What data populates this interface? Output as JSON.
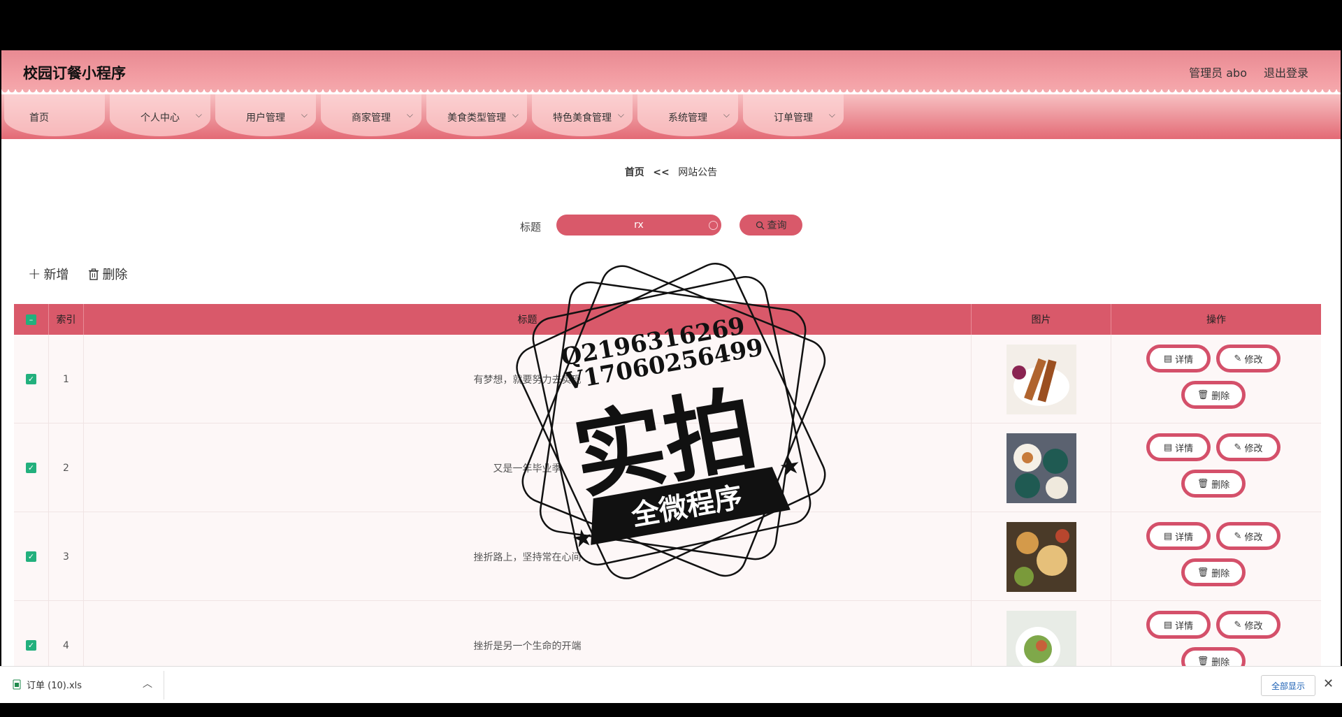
{
  "header": {
    "title": "校园订餐小程序",
    "user": "管理员 abo",
    "logout": "退出登录"
  },
  "nav": [
    {
      "label": "首页",
      "has_menu": false
    },
    {
      "label": "个人中心",
      "has_menu": true
    },
    {
      "label": "用户管理",
      "has_menu": true
    },
    {
      "label": "商家管理",
      "has_menu": true
    },
    {
      "label": "美食类型管理",
      "has_menu": true
    },
    {
      "label": "特色美食管理",
      "has_menu": true
    },
    {
      "label": "系统管理",
      "has_menu": true
    },
    {
      "label": "订单管理",
      "has_menu": true
    }
  ],
  "breadcrumb": {
    "home": "首页",
    "sep": "<<",
    "current": "网站公告"
  },
  "search": {
    "label": "标题",
    "value": "rx",
    "button": "查询"
  },
  "toolbar": {
    "add": "新增",
    "delete": "删除"
  },
  "table": {
    "columns": {
      "index": "索引",
      "title": "标题",
      "image": "图片",
      "actions": "操作"
    },
    "rows": [
      {
        "index": "1",
        "title": "有梦想，就要努力去实现",
        "checked": true,
        "image": "food-skewers"
      },
      {
        "index": "2",
        "title": "又是一年毕业季",
        "checked": true,
        "image": "food-plates"
      },
      {
        "index": "3",
        "title": "挫折路上，坚持常在心间",
        "checked": true,
        "image": "food-platter"
      },
      {
        "index": "4",
        "title": "挫折是另一个生命的开端",
        "checked": true,
        "image": "food-salad"
      }
    ],
    "action_labels": {
      "detail": "详情",
      "edit": "修改",
      "delete": "删除"
    }
  },
  "downloads": {
    "file": "订单 (10).xls",
    "show_all": "全部显示"
  },
  "watermark": {
    "line1": "Q2196316269",
    "line2": "V17060256499",
    "main": "实拍",
    "banner": "全微程序"
  },
  "colors": {
    "primary": "#d9596a",
    "header": "#f29ca2",
    "checkbox": "#22b07d"
  }
}
